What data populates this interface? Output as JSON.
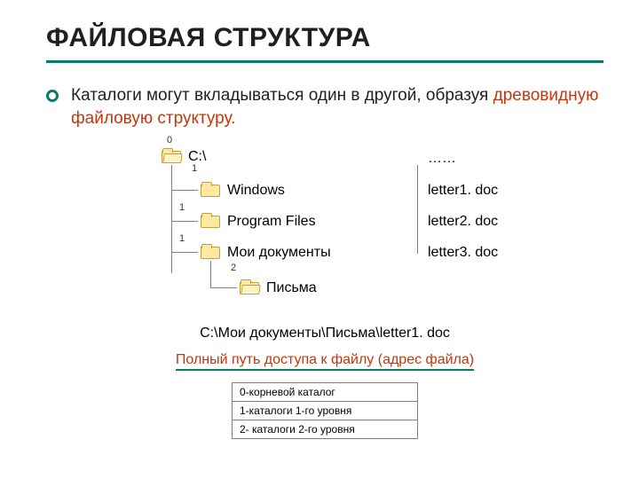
{
  "title": "ФАЙЛОВАЯ СТРУКТУРА",
  "body": {
    "part1": "Каталоги могут вкладываться один в другой, образуя ",
    "highlight": "древовидную файловую структуру.",
    "part2": ""
  },
  "tree": {
    "root": {
      "num": "0",
      "label": "C:\\"
    },
    "level1": [
      {
        "num": "1",
        "label": "Windows"
      },
      {
        "num": "1",
        "label": "Program Files"
      },
      {
        "num": "1",
        "label": "Мои документы"
      }
    ],
    "level2": {
      "num": "2",
      "label": "Письма"
    },
    "rightHeader": "……",
    "rightFiles": [
      "letter1. doc",
      "letter2. doc",
      "letter3. doc"
    ]
  },
  "path": "C:\\Мои документы\\Письма\\letter1. doc",
  "caption": "Полный путь доступа к файлу (адрес файла)",
  "legend": [
    "0-корневой каталог",
    "1-каталоги 1-го уровня",
    "2- каталоги 2-го уровня"
  ]
}
